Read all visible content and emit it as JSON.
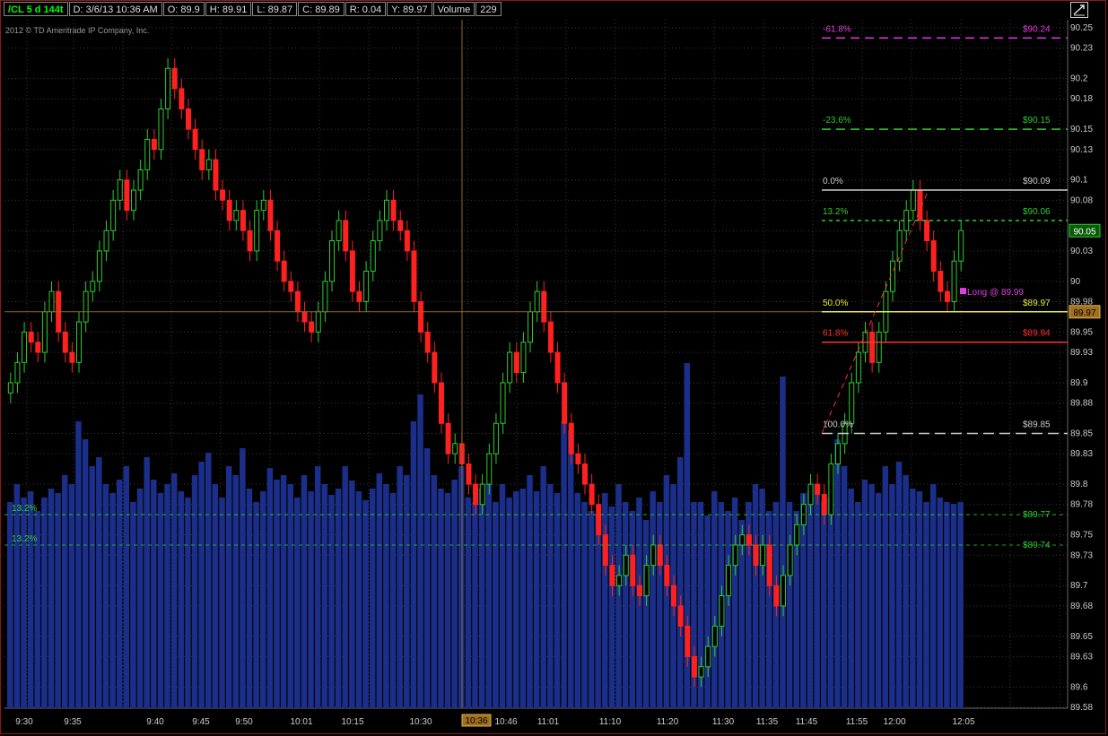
{
  "header": {
    "symbol": "/CL 5 d 144t",
    "date": "D: 3/6/13 10:36 AM",
    "open": "O: 89.9",
    "high": "H: 89.91",
    "low": "L: 89.87",
    "close": "C: 89.89",
    "range": "R: 0.04",
    "y": "Y: 89.97",
    "volume_label": "Volume",
    "volume_value": "229"
  },
  "copyright": "2012 © TD Ameritrade IP Company, Inc.",
  "colors": {
    "up": "#2ecc2e",
    "down": "#ff2020",
    "volume": "#1b2f8a",
    "grid": "#3a3a3a",
    "crosshair": "#8a6a2a"
  },
  "chart_data": {
    "type": "candlestick",
    "ylim": [
      89.58,
      90.25
    ],
    "price_ticks": [
      "90.25",
      "90.23",
      "90.2",
      "90.18",
      "90.15",
      "90.13",
      "90.1",
      "90.08",
      "90.05",
      "90.03",
      "90",
      "89.98",
      "89.95",
      "89.93",
      "89.9",
      "89.88",
      "89.85",
      "89.83",
      "89.8",
      "89.78",
      "89.75",
      "89.73",
      "89.7",
      "89.68",
      "89.65",
      "89.63",
      "89.6",
      "89.58"
    ],
    "time_labels": [
      "9:30",
      "9:35",
      "9:40",
      "9:45",
      "9:50",
      "10:01",
      "10:15",
      "10:30",
      "10:36",
      "10:46",
      "11:01",
      "11:10",
      "11:20",
      "11:30",
      "11:35",
      "11:45",
      "11:55",
      "12:00",
      "12:05"
    ],
    "cursor_time": "10:36",
    "last_price": "90.05",
    "y_price": "89.97",
    "fib_levels": [
      {
        "pct": "-61.8%",
        "price": "$90.24",
        "value": 90.24,
        "color": "#e040e0",
        "dash": "10,6"
      },
      {
        "pct": "-23.6%",
        "price": "$90.15",
        "value": 90.15,
        "color": "#2ecc2e",
        "dash": "10,6"
      },
      {
        "pct": "0.0%",
        "price": "$90.09",
        "value": 90.09,
        "color": "#cccccc",
        "dash": ""
      },
      {
        "pct": "13.2%",
        "price": "$90.06",
        "value": 90.06,
        "color": "#2ecc2e",
        "dash": "4,4"
      },
      {
        "pct": "50.0%",
        "price": "$89.97",
        "value": 89.97,
        "color": "#e8e840",
        "dash": ""
      },
      {
        "pct": "61.8%",
        "price": "$89.94",
        "value": 89.94,
        "color": "#ff3030",
        "dash": ""
      },
      {
        "pct": "100.0%",
        "price": "$89.85",
        "value": 89.85,
        "color": "#cccccc",
        "dash": "12,6"
      }
    ],
    "lower_levels": [
      {
        "pct": "13.2%",
        "price": "$89.77",
        "value": 89.77
      },
      {
        "pct": "13.2%",
        "price": "$89.74",
        "value": 89.74
      }
    ],
    "annotation": "Long @ 89.99",
    "series": [
      {
        "name": "price",
        "values": [
          89.9,
          89.92,
          89.95,
          89.94,
          89.93,
          89.97,
          89.99,
          89.95,
          89.93,
          89.92,
          89.96,
          89.99,
          90,
          90.03,
          90.05,
          90.08,
          90.1,
          90.07,
          90.09,
          90.11,
          90.14,
          90.13,
          90.17,
          90.21,
          90.19,
          90.17,
          90.15,
          90.13,
          90.11,
          90.12,
          90.09,
          90.08,
          90.06,
          90.07,
          90.05,
          90.03,
          90.07,
          90.08,
          90.05,
          90.02,
          90,
          89.99,
          89.97,
          89.96,
          89.95,
          89.97,
          90.0,
          90.04,
          90.06,
          90.03,
          89.99,
          89.98,
          90.01,
          90.04,
          90.06,
          90.08,
          90.06,
          90.05,
          90.03,
          89.98,
          89.95,
          89.93,
          89.9,
          89.86,
          89.83,
          89.84,
          89.82,
          89.8,
          89.78,
          89.8,
          89.83,
          89.86,
          89.9,
          89.93,
          89.91,
          89.94,
          89.97,
          89.99,
          89.96,
          89.93,
          89.9,
          89.86,
          89.83,
          89.82,
          89.8,
          89.78,
          89.75,
          89.72,
          89.7,
          89.71,
          89.73,
          89.7,
          89.69,
          89.72,
          89.74,
          89.72,
          89.7,
          89.68,
          89.66,
          89.63,
          89.61,
          89.62,
          89.64,
          89.66,
          89.69,
          89.72,
          89.74,
          89.75,
          89.74,
          89.72,
          89.74,
          89.7,
          89.68,
          89.71,
          89.74,
          89.76,
          89.78,
          89.8,
          89.79,
          89.77,
          89.82,
          89.84,
          89.86,
          89.9,
          89.93,
          89.95,
          89.92,
          89.95,
          89.99,
          90.02,
          90.05,
          90.07,
          90.09,
          90.06,
          90.04,
          90.01,
          89.99,
          89.98,
          90.02,
          90.05
        ]
      }
    ]
  }
}
